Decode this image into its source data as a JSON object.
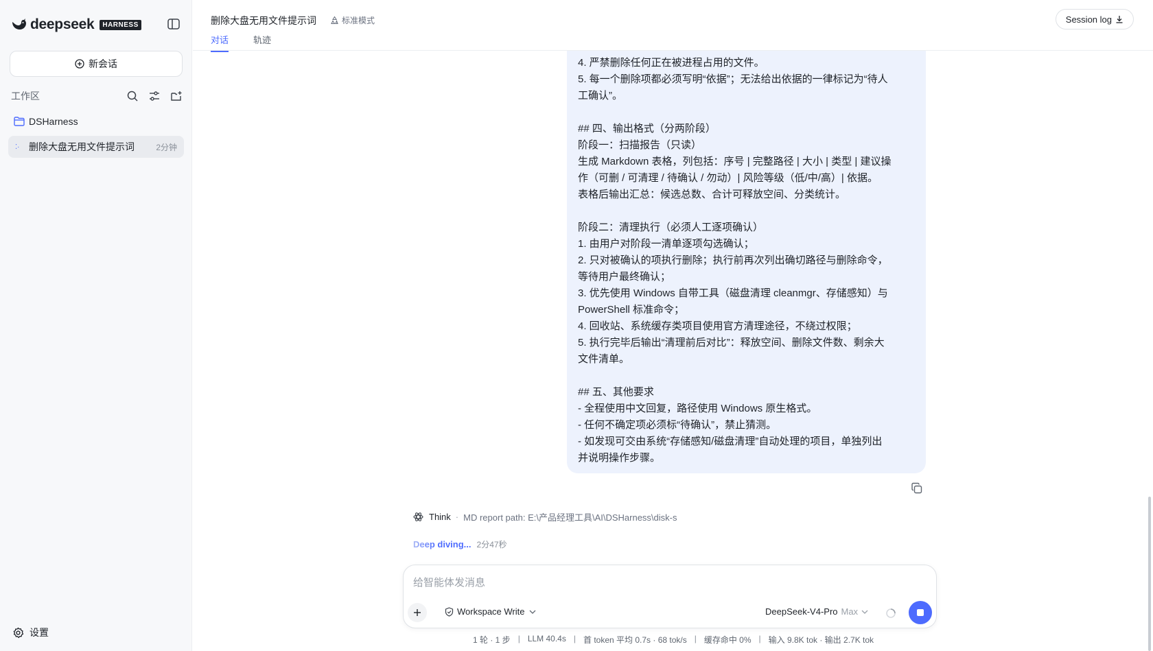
{
  "sidebar": {
    "brand_name": "deepseek",
    "brand_badge": "HARNESS",
    "new_chat_label": "新会话",
    "workspace_label": "工作区",
    "folder_name": "DSHarness",
    "session": {
      "title": "删除大盘无用文件提示词",
      "time": "2分钟"
    },
    "settings_label": "设置"
  },
  "header": {
    "title": "删除大盘无用文件提示词",
    "mode": "标准模式",
    "tabs": [
      {
        "label": "对话"
      },
      {
        "label": "轨迹"
      }
    ],
    "session_log_label": "Session log"
  },
  "message": {
    "lines": [
      "4. 严禁删除任何正在被进程占用的文件。",
      "5. 每一个删除项都必须写明“依据”；无法给出依据的一律标记为“待人",
      "工确认”。",
      "",
      "## 四、输出格式（分两阶段）",
      "阶段一：扫描报告（只读）",
      "生成 Markdown 表格，列包括：序号 | 完整路径 | 大小 | 类型 | 建议操",
      "作（可删 / 可清理 / 待确认 / 勿动）| 风险等级（低/中/高）| 依据。",
      "表格后输出汇总：候选总数、合计可释放空间、分类统计。",
      "",
      "阶段二：清理执行（必须人工逐项确认）",
      "1. 由用户对阶段一清单逐项勾选确认；",
      "2. 只对被确认的项执行删除；执行前再次列出确切路径与删除命令，",
      "等待用户最终确认；",
      "3. 优先使用 Windows 自带工具（磁盘清理 cleanmgr、存储感知）与",
      "PowerShell 标准命令；",
      "4. 回收站、系统缓存类项目使用官方清理途径，不绕过权限；",
      "5. 执行完毕后输出“清理前后对比”：释放空间、删除文件数、剩余大",
      "文件清单。",
      "",
      "## 五、其他要求",
      "- 全程使用中文回复，路径使用 Windows 原生格式。",
      "- 任何不确定项必须标“待确认”，禁止猜测。",
      "- 如发现可交由系统“存储感知/磁盘清理”自动处理的项目，单独列出",
      "并说明操作步骤。"
    ]
  },
  "think": {
    "label": "Think",
    "separator": "·",
    "path_text": "MD report path: E:\\产品经理工具\\AI\\DSHarness\\disk-s"
  },
  "progress": {
    "label": "Deep diving...",
    "elapsed": "2分47秒"
  },
  "composer": {
    "placeholder": "给智能体发消息",
    "permission": "Workspace Write",
    "model": "DeepSeek-V4-Pro",
    "model_tier": "Max"
  },
  "status": {
    "items": [
      "1 轮 · 1 步",
      "LLM 40.4s",
      "首 token 平均 0.7s · 68 tok/s",
      "缓存命中 0%",
      "输入 9.8K tok · 输出 2.7K tok"
    ],
    "separator": "|"
  },
  "colors": {
    "accent": "#4d6bfe",
    "bubble_bg": "#edf2fd",
    "sidebar_bg": "#f7f8fa"
  }
}
